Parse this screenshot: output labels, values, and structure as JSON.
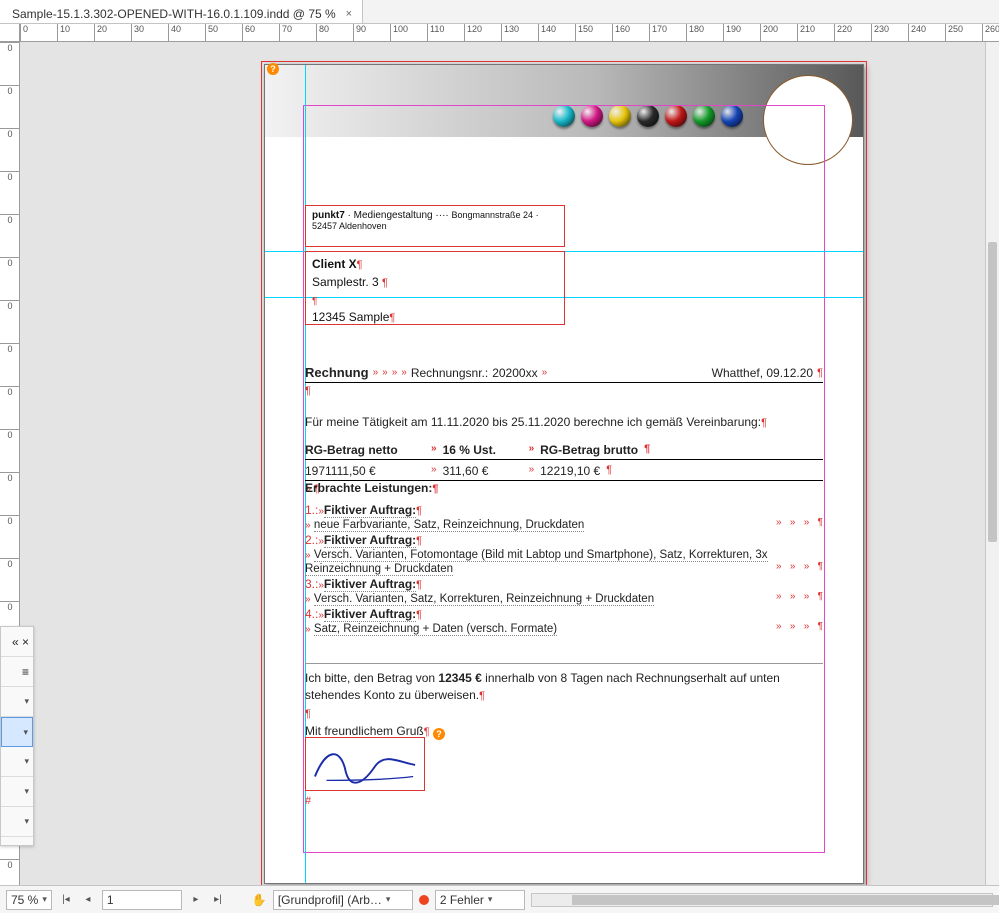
{
  "tab": {
    "title": "Sample-15.1.3.302-OPENED-WITH-16.0.1.109.indd @ 75 %"
  },
  "ruler": {
    "h": [
      "0",
      "10",
      "20",
      "30",
      "40",
      "50",
      "60",
      "70",
      "80",
      "90",
      "100",
      "110",
      "120",
      "130",
      "140",
      "150",
      "160",
      "170",
      "180",
      "190",
      "200",
      "210",
      "220",
      "230",
      "240",
      "250",
      "260"
    ],
    "v": [
      "0",
      "0",
      "0",
      "0",
      "0",
      "0",
      "0",
      "0",
      "0",
      "0",
      "0",
      "0",
      "0",
      "0",
      "0",
      "0",
      "0",
      "0",
      "0",
      "0"
    ]
  },
  "icons_palette": [
    "#18b8c9",
    "#d11884",
    "#e6c40c",
    "#2a2a2a",
    "#c01717",
    "#149b2a",
    "#1544b5"
  ],
  "sender": {
    "brand": "punkt7",
    "suffix": " · Mediengestaltung",
    "address": "Bongmannstraße 24 · 52457 Aldenhoven"
  },
  "client": {
    "name": "Client X",
    "street": "Samplestr. 3",
    "city": "12345 Sample"
  },
  "invoice": {
    "label": "Rechnung",
    "nr_label": "Rechnungsnr.: ",
    "nr": "20200xx",
    "place_date": "Whatthef, 09.12.20",
    "line2": "Für meine Tätigkeit am 11.11.2020 bis 25.11.2020 berechne ich gemäß Vereinbarung:",
    "cols": {
      "net": "RG-Betrag netto",
      "vat": "16 % Ust.",
      "gross": "RG-Betrag brutto"
    },
    "vals": {
      "net": "1971111,50 €",
      "vat": "311,60 €",
      "gross": "12219,10 €"
    }
  },
  "services": {
    "title": "Erbrachte Leistungen:",
    "items": [
      {
        "n": "1.:",
        "t": "Fiktiver Auftrag:",
        "d": "neue Farbvariante, Satz, Reinzeichnung, Druckdaten"
      },
      {
        "n": "2.:",
        "t": "Fiktiver Auftrag:",
        "d": "Versch. Varianten, Fotomontage (Bild mit Labtop und Smartphone), Satz, Korrekturen, 3x Reinzeichnung + Druckdaten"
      },
      {
        "n": "3.:",
        "t": "Fiktiver Auftrag:",
        "d": "Versch. Varianten, Satz, Korrekturen, Reinzeichnung + Druckdaten"
      },
      {
        "n": "4.:",
        "t": "Fiktiver Auftrag:",
        "d": "Satz, Reinzeichnung + Daten (versch. Formate)"
      }
    ]
  },
  "footer": {
    "text_a": "Ich bitte, den Betrag von ",
    "amount": "12345 €",
    "text_b": " innerhalb von 8 Tagen nach Rechnungserhalt auf unten stehendes Konto zu überweisen.",
    "greeting": "Mit freundlichem Gruß"
  },
  "status": {
    "zoom": "75 %",
    "page": "1",
    "profile": "[Grundprofil] (Arb…",
    "errors_label": "2 Fehler"
  }
}
